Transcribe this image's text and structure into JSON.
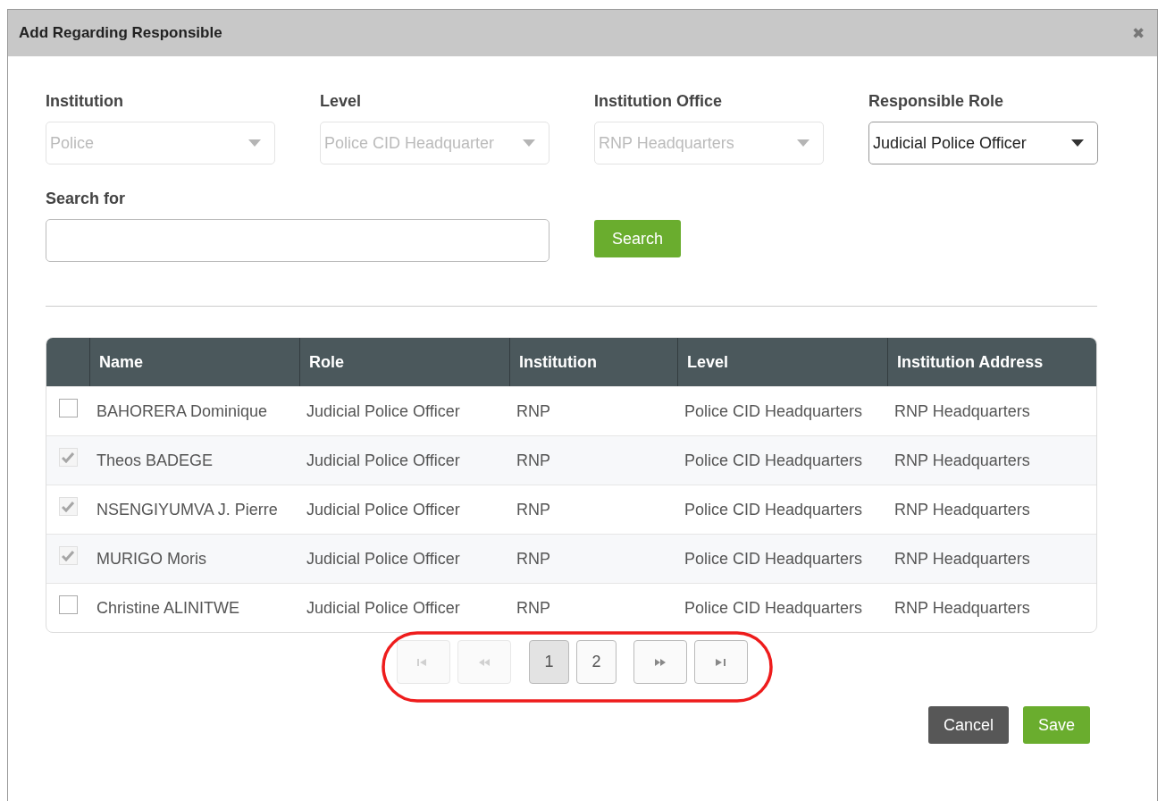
{
  "dialog": {
    "title": "Add Regarding Responsible",
    "close": "✖"
  },
  "filters": [
    {
      "label": "Institution",
      "value": "Police",
      "disabled": true
    },
    {
      "label": "Level",
      "value": "Police CID Headquarter",
      "disabled": true
    },
    {
      "label": "Institution Office",
      "value": "RNP Headquarters",
      "disabled": true
    },
    {
      "label": "Responsible Role",
      "value": "Judicial Police Officer",
      "disabled": false
    }
  ],
  "search": {
    "label": "Search for",
    "button": "Search"
  },
  "table": {
    "columns": [
      "Name",
      "Role",
      "Institution",
      "Level",
      "Institution Address"
    ],
    "rows": [
      {
        "checked": false,
        "disabled": false,
        "cells": [
          "BAHORERA Dominique",
          "Judicial Police Officer",
          "RNP",
          "Police CID Headquarters",
          "RNP Headquarters"
        ]
      },
      {
        "checked": true,
        "disabled": true,
        "cells": [
          "Theos BADEGE",
          "Judicial Police Officer",
          "RNP",
          "Police CID Headquarters",
          "RNP Headquarters"
        ]
      },
      {
        "checked": true,
        "disabled": true,
        "cells": [
          "NSENGIYUMVA J. Pierre",
          "Judicial Police Officer",
          "RNP",
          "Police CID Headquarters",
          "RNP Headquarters"
        ]
      },
      {
        "checked": true,
        "disabled": true,
        "cells": [
          "MURIGO Moris",
          "Judicial Police Officer",
          "RNP",
          "Police CID Headquarters",
          "RNP Headquarters"
        ]
      },
      {
        "checked": false,
        "disabled": false,
        "cells": [
          "Christine ALINITWE",
          "Judicial Police Officer",
          "RNP",
          "Police CID Headquarters",
          "RNP Headquarters"
        ]
      }
    ]
  },
  "pagination": [
    {
      "kind": "first",
      "disabled": true
    },
    {
      "kind": "prev",
      "disabled": true
    },
    {
      "kind": "page",
      "label": "1",
      "selected": true
    },
    {
      "kind": "page",
      "label": "2",
      "selected": false
    },
    {
      "kind": "next",
      "disabled": false
    },
    {
      "kind": "last",
      "disabled": false
    }
  ],
  "annotation": {
    "kind": "ellipse"
  },
  "buttons": [
    {
      "kind": "cancel",
      "label": "Cancel"
    },
    {
      "kind": "save",
      "label": "Save"
    }
  ]
}
